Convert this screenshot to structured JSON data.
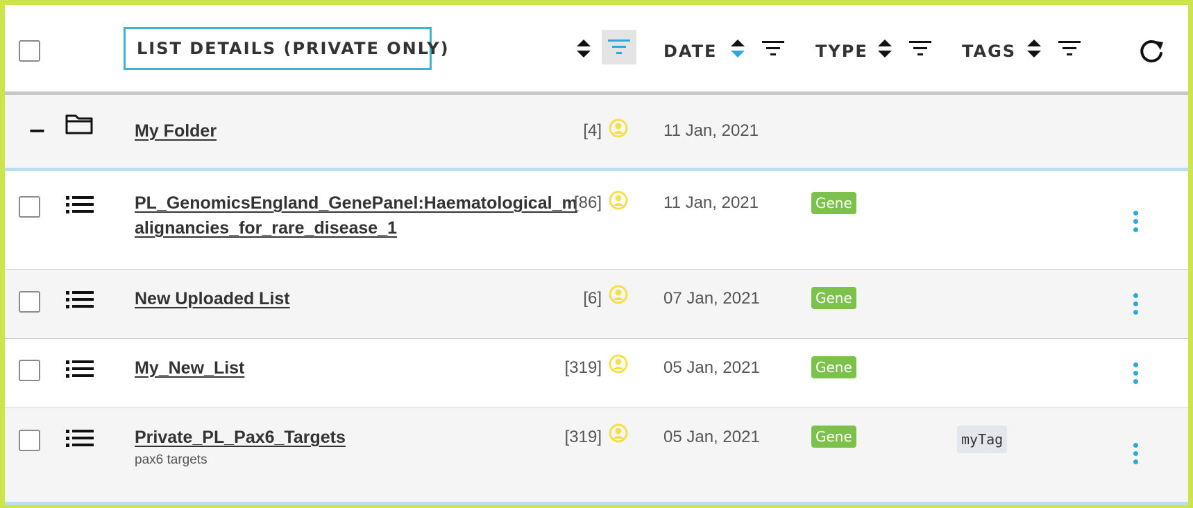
{
  "header": {
    "title": "LIST DETAILS (PRIVATE ONLY)",
    "date_label": "DATE",
    "type_label": "TYPE",
    "tags_label": "TAGS"
  },
  "folder": {
    "name": "My Folder",
    "count": "[4]",
    "date": "11 Jan, 2021",
    "collapse_symbol": "−"
  },
  "lists": [
    {
      "name_line1": "PL_GenomicsEngland_GenePanel:Haematological_m",
      "name_line2": "alignancies_for_rare_disease_1",
      "count": "[86]",
      "date": "11 Jan, 2021",
      "type": "Gene",
      "description": "",
      "tag": ""
    },
    {
      "name_line1": "New Uploaded List",
      "name_line2": "",
      "count": "[6]",
      "date": "07 Jan, 2021",
      "type": "Gene",
      "description": "",
      "tag": ""
    },
    {
      "name_line1": "My_New_List",
      "name_line2": "",
      "count": "[319]",
      "date": "05 Jan, 2021",
      "type": "Gene",
      "description": "",
      "tag": ""
    },
    {
      "name_line1": "Private_PL_Pax6_Targets",
      "name_line2": "",
      "count": "[319]",
      "date": "05 Jan, 2021",
      "type": "Gene",
      "description": "pax6 targets",
      "tag": "myTag"
    }
  ],
  "colors": {
    "frame": "#cde54a",
    "title_border": "#3db4cf",
    "type_badge": "#7cc24a",
    "owner_icon": "#f6e04a",
    "kebab": "#2ba8e0",
    "sort_active": "#2ba8e0"
  },
  "icons": {
    "select_all": "checkbox-icon",
    "sort": "sort-icon",
    "filter": "filter-icon",
    "refresh": "refresh-icon",
    "folder": "folder-icon",
    "list": "list-icon",
    "owner": "user-circle-icon",
    "menu": "kebab-menu-icon"
  }
}
